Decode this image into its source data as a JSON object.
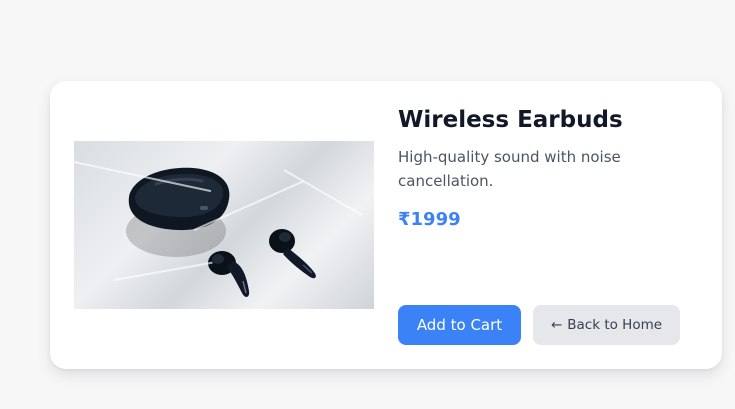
{
  "product": {
    "title": "Wireless Earbuds",
    "description": "High-quality sound with noise cancellation.",
    "price": "₹1999",
    "image_alt": "Wireless earbuds on a marble surface"
  },
  "actions": {
    "add_to_cart_label": "Add to Cart",
    "back_icon": "←",
    "back_label": "Back to Home"
  },
  "colors": {
    "accent": "#3b82f6",
    "title": "#111827",
    "text": "#4b5563",
    "secondary_button": "#e5e7eb",
    "page_background": "#f7f7f8"
  }
}
